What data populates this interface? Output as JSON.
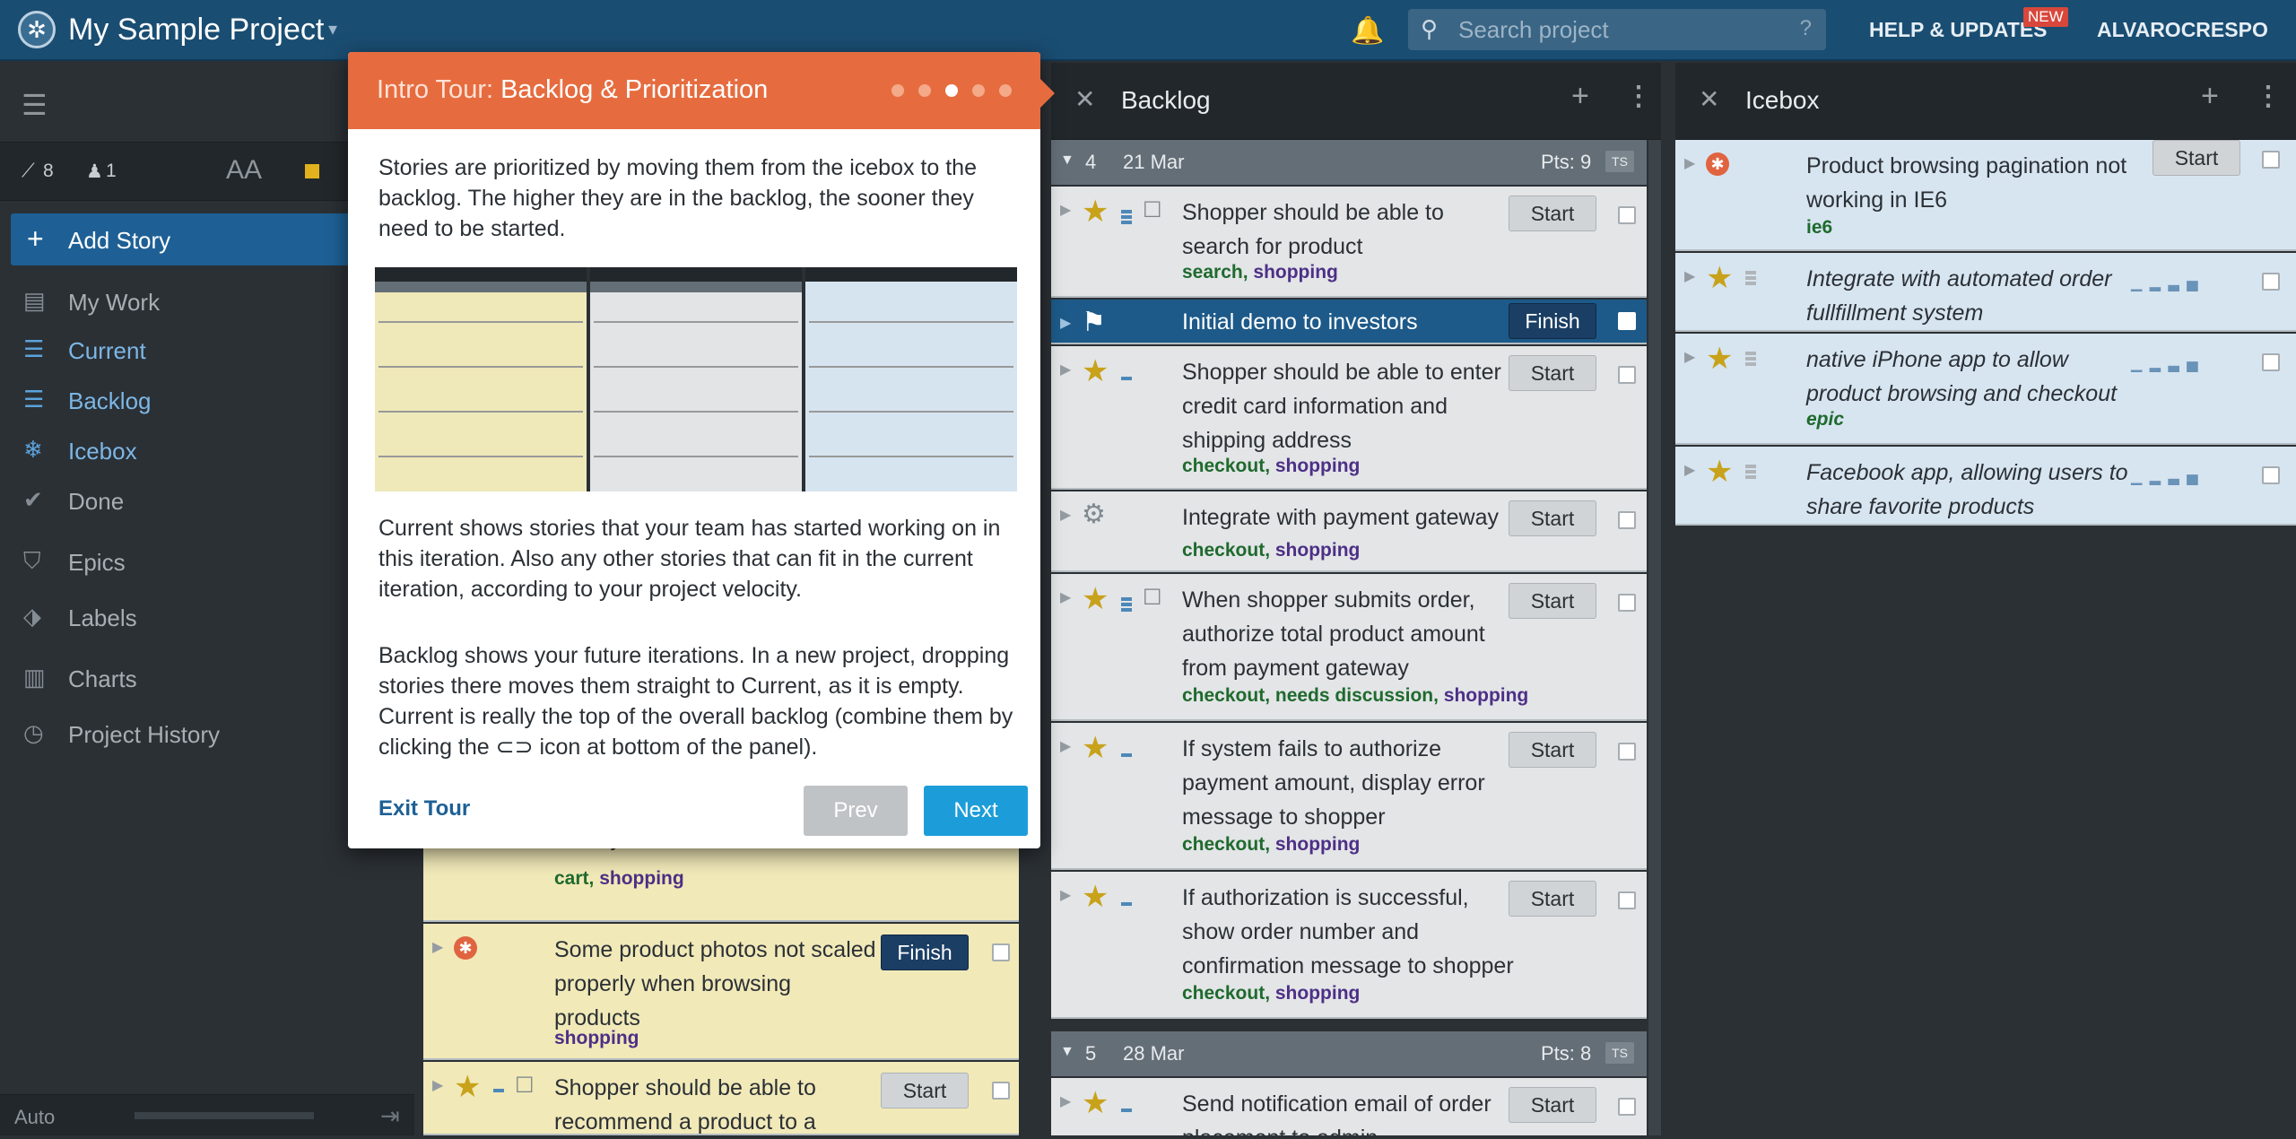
{
  "header": {
    "project_name": "My Sample Project",
    "search_placeholder": "Search project",
    "search_help": "?",
    "help_label": "HELP & UPDATES",
    "new_badge": "NEW",
    "user": "ALVAROCRESPO"
  },
  "sidebar": {
    "stats": {
      "velocity": "8",
      "members": "1"
    },
    "font_toggle": "AA",
    "add_story": "Add Story",
    "items": [
      {
        "label": "My Work"
      },
      {
        "label": "Current"
      },
      {
        "label": "Backlog"
      },
      {
        "label": "Icebox"
      },
      {
        "label": "Done"
      },
      {
        "label": "Epics"
      },
      {
        "label": "Labels"
      },
      {
        "label": "Charts"
      },
      {
        "label": "Project History"
      }
    ],
    "footer": {
      "auto": "Auto"
    }
  },
  "tour": {
    "prefix": "Intro Tour: ",
    "title": "Backlog & Prioritization",
    "step": 3,
    "steps": 5,
    "p1": "Stories are prioritized by moving them from the icebox to the backlog. The higher they are in the backlog, the sooner they need to be started.",
    "p2": "Current shows stories that your team has started working on in this iteration. Also any other stories that can fit in the current iteration, according to your project velocity.",
    "p3": "Backlog shows your future iterations. In a new project, dropping stories there moves them straight to Current, as it is empty. Current is really the top of the overall backlog (combine them by clicking the ⊂⊃ icon at bottom of the panel).",
    "exit": "Exit Tour",
    "prev": "Prev",
    "next": "Next"
  },
  "current": {
    "partial_title": "AJAXy",
    "partial_labels_a": "cart",
    "partial_labels_b": "shopping",
    "story2_title": "Some product photos not scaled properly when browsing products",
    "story2_label": "shopping",
    "story2_btn": "Finish",
    "story3_title": "Shopper should be able to recommend a product to a",
    "story3_btn": "Start"
  },
  "backlog": {
    "title": "Backlog",
    "iter1": {
      "num": "4",
      "date": "21 Mar",
      "pts": "Pts: 9",
      "ts": "TS"
    },
    "iter2": {
      "num": "5",
      "date": "28 Mar",
      "pts": "Pts: 8",
      "ts": "TS"
    },
    "stories": [
      {
        "title": "Shopper should be able to search for product",
        "la": "search",
        "lb": "shopping",
        "btn": "Start"
      },
      {
        "title": "Initial demo to investors",
        "btn": "Finish"
      },
      {
        "title": "Shopper should be able to enter credit card information and shipping address",
        "la": "checkout",
        "lb": "shopping",
        "btn": "Start"
      },
      {
        "title": "Integrate with payment gateway",
        "la": "checkout",
        "lb": "shopping",
        "btn": "Start"
      },
      {
        "title": "When shopper submits order, authorize total product amount from payment gateway",
        "la": "checkout",
        "lc": "needs discussion",
        "lb": "shopping",
        "btn": "Start"
      },
      {
        "title": "If system fails to authorize payment amount, display error message to shopper",
        "la": "checkout",
        "lb": "shopping",
        "btn": "Start"
      },
      {
        "title": "If authorization is successful, show order number and confirmation message to shopper",
        "la": "checkout",
        "lb": "shopping",
        "btn": "Start"
      },
      {
        "title": "Send notification email of order placement to admin",
        "btn": "Start"
      }
    ]
  },
  "icebox": {
    "title": "Icebox",
    "stories": [
      {
        "title": "Product browsing pagination not working in IE6",
        "label": "ie6",
        "btn": "Start"
      },
      {
        "title": "Integrate with automated order fullfillment system"
      },
      {
        "title": "native iPhone app to allow product browsing and checkout",
        "label": "epic"
      },
      {
        "title": "Facebook app, allowing users to share favorite products"
      }
    ]
  },
  "colors": {
    "topbar": "#1a4d72",
    "tour_header": "#e66c3f",
    "next_button": "#1c9dd9",
    "active_story": "#1d5a89"
  }
}
